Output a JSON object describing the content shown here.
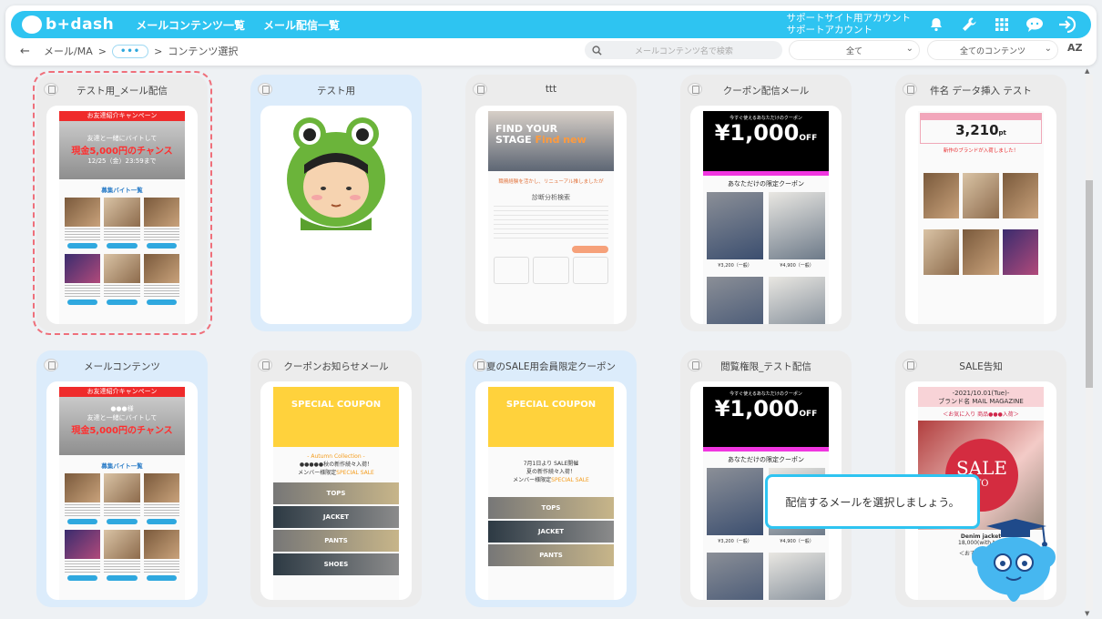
{
  "header": {
    "logo": "b+dash",
    "nav": [
      "メールコンテンツ一覧",
      "メール配信一覧"
    ],
    "account_line1": "サポートサイト用アカウント",
    "account_line2": "サポートアカウント",
    "icons": [
      "bell-icon",
      "wrench-icon",
      "grid-icon",
      "chat-icon",
      "logout-icon"
    ]
  },
  "toolbar": {
    "back_symbol": "←",
    "crumb_root": "メール/MA",
    "crumb_sep": ">",
    "crumb_dots": "•••",
    "crumb_current": "コンテンツ選択",
    "search_placeholder": "メールコンテンツ名で検索",
    "filter1": "全て",
    "filter2": "全てのコンテンツ",
    "sort_label": "AZ"
  },
  "cards": [
    {
      "title": "テスト用_メール配信",
      "type": "job",
      "selected": true
    },
    {
      "title": "テスト用",
      "type": "frog"
    },
    {
      "title": "ttt",
      "type": "ttt"
    },
    {
      "title": "クーポン配信メール",
      "type": "coupon"
    },
    {
      "title": "件名 データ挿入 テスト",
      "type": "kenmei"
    },
    {
      "title": "メールコンテンツ",
      "type": "job"
    },
    {
      "title": "クーポンお知らせメール",
      "type": "special"
    },
    {
      "title": "夏のSALE用会員限定クーポン",
      "type": "special2"
    },
    {
      "title": "閲覧権限_テスト配信",
      "type": "coupon"
    },
    {
      "title": "SALE告知",
      "type": "sale"
    }
  ],
  "thumb_text": {
    "job_banner": "お友達紹介キャンペーン",
    "job_hero1": "友達と一緒にバイトして",
    "job_hero2": "現金5,000円のチャンス",
    "job_hero3": "12/25（金）23:59まで",
    "job_hero_kana": "●●●様",
    "job_sub": "募集バイト一覧",
    "coupon_small": "今すぐ使えるあなただけのクーポン",
    "coupon_big": "¥1,000",
    "coupon_off": "OFF",
    "coupon_line": "あなただけの限定クーポン",
    "coupon_price1": "¥3,200（一般）",
    "coupon_price2": "¥4,900（一般）",
    "ttt_city1": "FIND YOUR",
    "ttt_city2": "STAGE",
    "ttt_city3": "Find new",
    "ttt_text": "職務経験を活かし、リニューアル推しましたが",
    "ttt_h": "診断分析検索",
    "kenmei_pt": "3,210",
    "kenmei_pt_unit": "pt",
    "kenmei_red": "新作のブランドが入荷しました！",
    "special_title": "SPECIAL COUPON",
    "special_autumn": "- Autumn Collection -",
    "special_new": "●●●●●秋の新作続々入荷！",
    "special_member": "メンバー様限定",
    "special_sale": "SPECIAL SALE",
    "special_summer": "7月1日より SALE開催",
    "special_summer2": "夏の新作続々入荷！",
    "band_tops": "TOPS",
    "band_jacket": "JACKET",
    "band_pants": "PANTS",
    "band_shoes": "SHOES",
    "sale_date": "-2021/10.01(Tue)-",
    "sale_brand": "ブランド名 MAIL MAGAZINE",
    "sale_notice": "＜お気に入り 商品●●●入荷＞",
    "sale_badge": "SALE",
    "sale_badge2": "TO",
    "sale_cap1": "Denim jacket",
    "sale_cap2": "18,000(with tax)",
    "sale_reco": "＜おすすめ商品＞"
  },
  "tooltip": "配信するメールを選択しましょう。"
}
